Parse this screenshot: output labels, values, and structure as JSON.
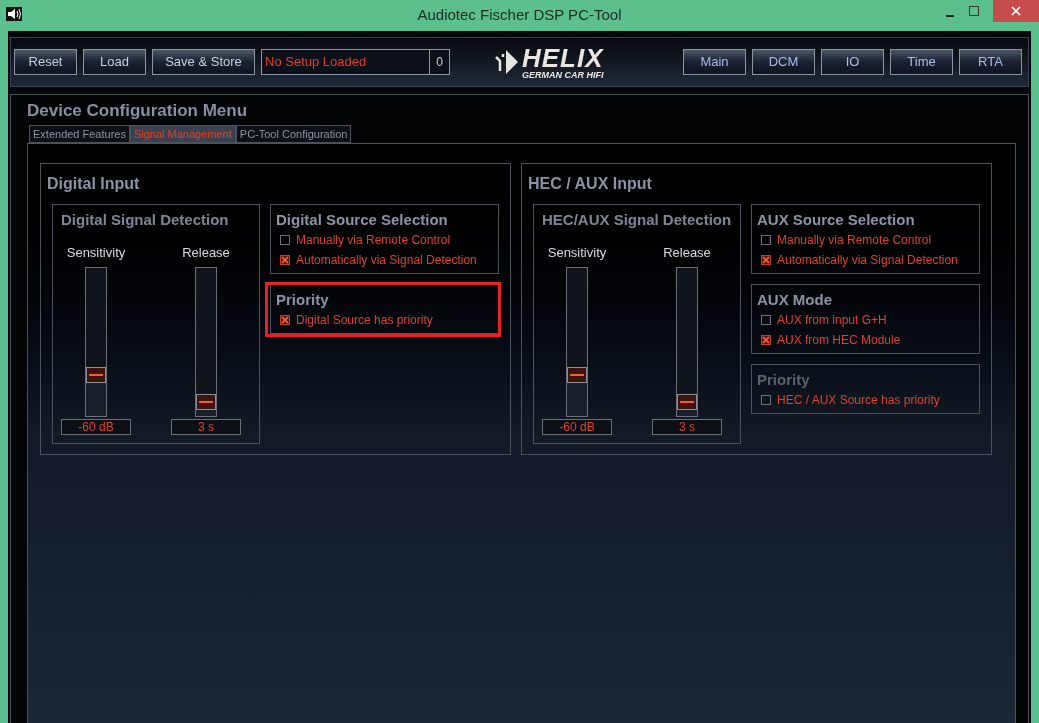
{
  "window": {
    "title": "Audiotec Fischer DSP PC-Tool"
  },
  "toolbar": {
    "buttons": [
      "Reset",
      "Load",
      "Save & Store"
    ],
    "setup_name": "No Setup Loaded",
    "setup_number": "0",
    "logo": {
      "brand": "HELIX",
      "tagline": "GERMAN CAR HIFI"
    },
    "nav_buttons": [
      "Main",
      "DCM",
      "IO",
      "Time",
      "RTA"
    ]
  },
  "menu": {
    "title": "Device Configuration Menu",
    "tabs": [
      {
        "label": "Extended Features",
        "selected": false
      },
      {
        "label": "Signal Management",
        "selected": true
      },
      {
        "label": "PC-Tool Configuration",
        "selected": false
      }
    ]
  },
  "panels": [
    {
      "title": "Digital Input",
      "detection": {
        "title": "Digital Signal Detection",
        "sliders": [
          {
            "label": "Sensitivity",
            "level": 0.25,
            "reading": "-60 dB"
          },
          {
            "label": "Release",
            "level": 0.04,
            "reading": "3 s"
          }
        ]
      },
      "groups": [
        {
          "title": "Digital Source Selection",
          "highlighted": false,
          "disabled": false,
          "options": [
            {
              "label": "Manually via Remote Control",
              "checked": false
            },
            {
              "label": "Automatically via Signal Detection",
              "checked": true
            }
          ]
        },
        {
          "title": "Priority",
          "highlighted": true,
          "disabled": false,
          "options": [
            {
              "label": "Digital Source has priority",
              "checked": true
            }
          ]
        }
      ]
    },
    {
      "title": "HEC / AUX Input",
      "detection": {
        "title": "HEC/AUX Signal Detection",
        "sliders": [
          {
            "label": "Sensitivity",
            "level": 0.25,
            "reading": "-60 dB"
          },
          {
            "label": "Release",
            "level": 0.04,
            "reading": "3 s"
          }
        ]
      },
      "groups": [
        {
          "title": "AUX Source Selection",
          "highlighted": false,
          "disabled": false,
          "options": [
            {
              "label": "Manually via Remote Control",
              "checked": false
            },
            {
              "label": "Automatically via Signal Detection",
              "checked": true
            }
          ]
        },
        {
          "title": "AUX Mode",
          "highlighted": false,
          "disabled": false,
          "options": [
            {
              "label": "AUX from input G+H",
              "checked": false
            },
            {
              "label": "AUX from HEC Module",
              "checked": true
            }
          ]
        },
        {
          "title": "Priority",
          "highlighted": false,
          "disabled": true,
          "options": [
            {
              "label": "HEC / AUX Source has priority",
              "checked": false
            }
          ]
        }
      ]
    }
  ]
}
